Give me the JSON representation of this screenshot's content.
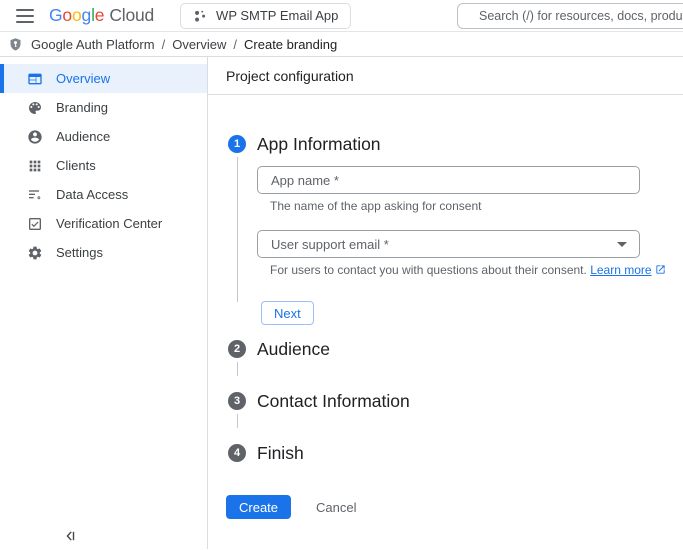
{
  "topbar": {
    "logo": {
      "letters": [
        "G",
        "o",
        "o",
        "g",
        "l",
        "e"
      ],
      "suffix": "Cloud"
    },
    "project_selector_label": "WP SMTP Email App",
    "search_placeholder": "Search (/) for resources, docs, products, a"
  },
  "breadcrumb": {
    "separator": "/",
    "items": [
      "Google Auth Platform",
      "Overview",
      "Create branding"
    ]
  },
  "sidebar": {
    "items": [
      {
        "label": "Overview",
        "icon": "overview-icon",
        "selected": true
      },
      {
        "label": "Branding",
        "icon": "palette-icon",
        "selected": false
      },
      {
        "label": "Audience",
        "icon": "person-icon",
        "selected": false
      },
      {
        "label": "Clients",
        "icon": "apps-grid-icon",
        "selected": false
      },
      {
        "label": "Data Access",
        "icon": "list-gear-icon",
        "selected": false
      },
      {
        "label": "Verification Center",
        "icon": "checkbox-icon",
        "selected": false
      },
      {
        "label": "Settings",
        "icon": "gear-icon",
        "selected": false
      }
    ]
  },
  "main": {
    "header_title": "Project configuration",
    "steps": [
      {
        "number": "1",
        "title": "App Information",
        "active": true
      },
      {
        "number": "2",
        "title": "Audience",
        "active": false
      },
      {
        "number": "3",
        "title": "Contact Information",
        "active": false
      },
      {
        "number": "4",
        "title": "Finish",
        "active": false
      }
    ],
    "form": {
      "app_name": {
        "placeholder": "App name *",
        "value": "",
        "helper": "The name of the app asking for consent"
      },
      "support_email": {
        "placeholder": "User support email *",
        "helper": "For users to contact you with questions about their consent.",
        "link_label": "Learn more"
      },
      "next_label": "Next"
    },
    "footer": {
      "create_label": "Create",
      "cancel_label": "Cancel"
    }
  },
  "colors": {
    "accent_blue": "#1a73e8",
    "text_primary": "#202124",
    "text_secondary": "#5f6368",
    "border_gray": "#dadce0",
    "selected_item_bg": "#e9f1fd",
    "active_step_circle": "#1a73e8",
    "inactive_step_circle": "#5f6368",
    "create_button_bg": "#1a73e8",
    "google_logo_letter_colors": [
      "#4285F4",
      "#EA4335",
      "#FBBC05",
      "#4285F4",
      "#34A853",
      "#EA4335"
    ]
  }
}
